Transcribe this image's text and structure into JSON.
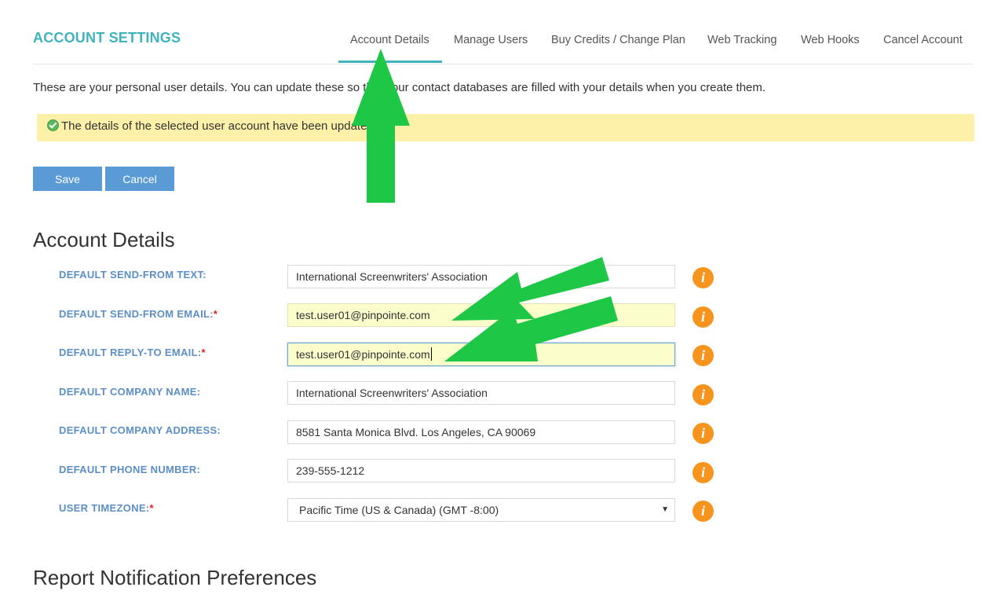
{
  "header": {
    "title": "ACCOUNT SETTINGS",
    "tabs": [
      {
        "label": "Account Details",
        "active": true
      },
      {
        "label": "Manage Users"
      },
      {
        "label": "Buy Credits / Change Plan"
      },
      {
        "label": "Web Tracking"
      },
      {
        "label": "Web Hooks"
      },
      {
        "label": "Cancel Account"
      }
    ]
  },
  "intro_text": "These are your personal user details. You can update these so that your contact databases are filled with your details when you create them.",
  "alert": {
    "text": "The details of the selected user account have been updated."
  },
  "actions": {
    "save_label": "Save",
    "cancel_label": "Cancel"
  },
  "account_details": {
    "title": "Account Details",
    "fields": [
      {
        "label": "DEFAULT SEND-FROM TEXT:",
        "value": "International Screenwriters' Association"
      },
      {
        "label": "DEFAULT SEND-FROM EMAIL:",
        "required_mark": "*",
        "value": "test.user01@pinpointe.com"
      },
      {
        "label": "DEFAULT REPLY-TO EMAIL:",
        "required_mark": "*",
        "value": "test.user01@pinpointe.com"
      },
      {
        "label": "DEFAULT COMPANY NAME:",
        "value": "International Screenwriters' Association"
      },
      {
        "label": "DEFAULT COMPANY ADDRESS:",
        "value": "8581 Santa Monica Blvd. Los Angeles, CA 90069"
      },
      {
        "label": "DEFAULT PHONE NUMBER:",
        "value": "239-555-1212"
      },
      {
        "label": "USER TIMEZONE:",
        "required_mark": "*",
        "value": "Pacific Time (US & Canada) (GMT -8:00)"
      }
    ],
    "info_glyph": "i"
  },
  "report_section": {
    "title": "Report Notification Preferences"
  },
  "colors": {
    "accent_teal": "#3fb3be",
    "button_blue": "#5b9bd5",
    "label_blue": "#5b8fc5",
    "alert_yellow": "#fdf0a8",
    "info_orange": "#f7941d",
    "annotation_green": "#1ec745"
  },
  "icons": {
    "alert": "check-circle-icon",
    "info": "info-icon",
    "select": "caret-down-icon"
  }
}
